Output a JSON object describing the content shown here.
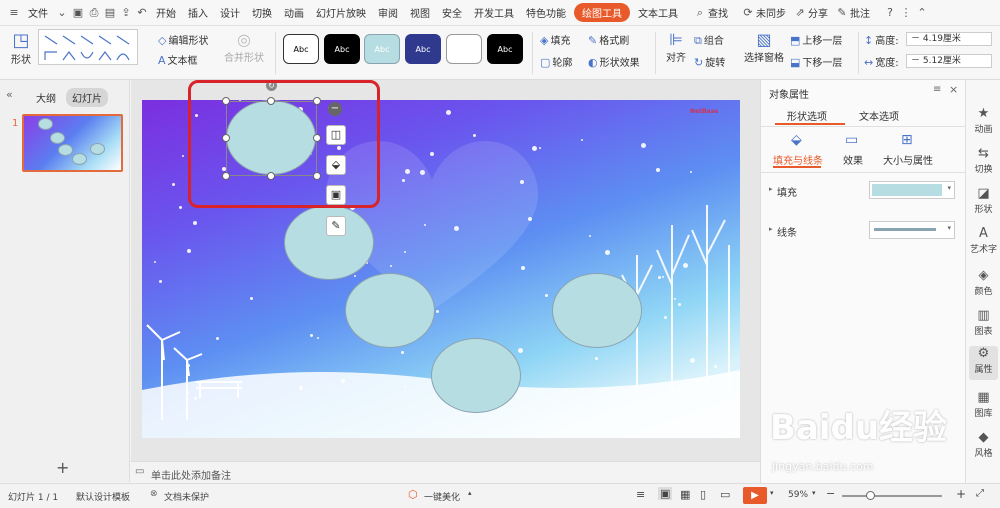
{
  "menu": {
    "file": "文件",
    "tabs": [
      "开始",
      "插入",
      "设计",
      "切换",
      "动画",
      "幻灯片放映",
      "审阅",
      "视图",
      "安全",
      "开发工具",
      "特色功能",
      "绘图工具",
      "文本工具"
    ],
    "active_tab": "绘图工具",
    "search": "查找",
    "sync": "未同步",
    "share": "分享",
    "comment": "批注"
  },
  "ribbon": {
    "shape_label": "形状",
    "edit_shape": "编辑形状",
    "text_box": "文本框",
    "merge_shape": "合并形状",
    "styles": [
      {
        "label": "Abc",
        "bg": "#ffffff",
        "fg": "#000000",
        "border": "#333333"
      },
      {
        "label": "Abc",
        "bg": "#000000",
        "fg": "#ffffff",
        "border": "#000000"
      },
      {
        "label": "Abc",
        "bg": "#b6dde2",
        "fg": "#ffffff",
        "border": "#8aa3b0"
      },
      {
        "label": "Abc",
        "bg": "#2f3a8f",
        "fg": "#ffffff",
        "border": "#2f3a8f"
      },
      {
        "label": "",
        "bg": "#ffffff",
        "fg": "#000000",
        "border": "#999999"
      },
      {
        "label": "Abc",
        "bg": "#000000",
        "fg": "#ffffff",
        "border": "#000000"
      }
    ],
    "fill": "填充",
    "format_painter": "格式刷",
    "outline": "轮廓",
    "shape_effect": "形状效果",
    "align": "对齐",
    "group": "组合",
    "rotate": "旋转",
    "selection_pane": "选择窗格",
    "bring_forward": "上移一层",
    "send_backward": "下移一层",
    "height_label": "高度:",
    "height_value": "4.19厘米",
    "width_label": "宽度:",
    "width_value": "5.12厘米"
  },
  "left_panel": {
    "outline_tab": "大纲",
    "slides_tab": "幻灯片",
    "slide_number": "1"
  },
  "slide": {
    "watermark": "NetBase"
  },
  "notes": {
    "placeholder": "单击此处添加备注"
  },
  "right_panel": {
    "title": "对象属性",
    "tabs": [
      "形状选项",
      "文本选项"
    ],
    "active_tab": "形状选项",
    "subtabs": [
      "填充与线条",
      "效果",
      "大小与属性"
    ],
    "active_subtab": "填充与线条",
    "fill_label": "填充",
    "line_label": "线条",
    "fill_color": "#b6dde2",
    "line_color": "#8aa3b0"
  },
  "side_bar": {
    "items": [
      "动画",
      "切换",
      "形状",
      "艺术字",
      "颜色",
      "图表",
      "属性",
      "图库",
      "风格"
    ]
  },
  "status_bar": {
    "slide_info": "幻灯片 1 / 1",
    "template": "默认设计模板",
    "protect": "文档未保护",
    "beautify": "一键美化",
    "zoom": "59%"
  },
  "watermark_text": {
    "baidu": "Baidu经验",
    "url": "jingyan.baidu.com"
  },
  "colors": {
    "accent": "#e95a2a",
    "selection_box": "#d8232a"
  }
}
